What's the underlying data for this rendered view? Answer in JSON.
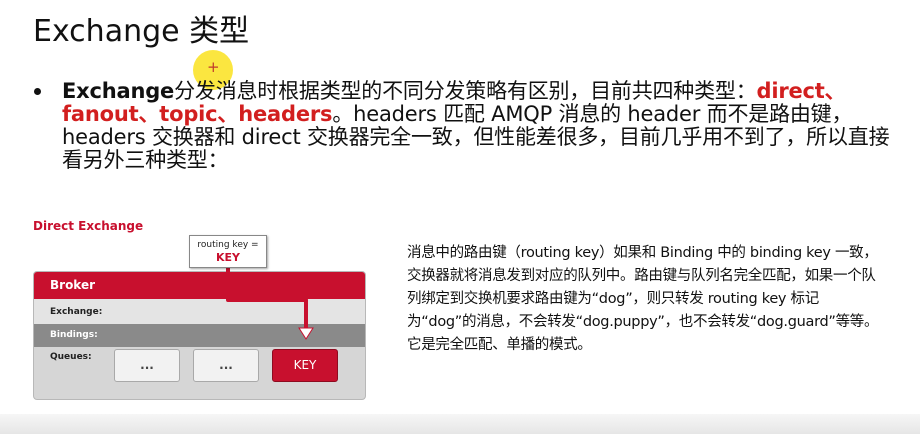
{
  "slide": {
    "title": "Exchange 类型",
    "bullet": {
      "lead": "Exchange",
      "text_1": "分发消息时根据类型的不同分发策略有区别，目前共四种类型：",
      "types": "direct、fanout、topic、headers",
      "text_2": "。headers 匹配 AMQP 消息的 header 而不是路由键， headers 交换器和 direct 交换器完全一致，但性能差很多，目前几乎用不到了，所以直接看另外三种类型："
    },
    "diagram": {
      "title": "Direct Exchange",
      "routing_key_label": "routing key =",
      "routing_key_value": "KEY",
      "broker_label": "Broker",
      "exchange_label": "Exchange:",
      "bindings_label": "Bindings:",
      "queues_label": "Queues:",
      "queues": [
        "...",
        "...",
        "KEY"
      ]
    },
    "description": "消息中的路由键（routing key）如果和 Binding 中的 binding key 一致， 交换器就将消息发到对应的队列中。路由键与队列名完全匹配，如果一个队列绑定到交换机要求路由键为“dog”，则只转发 routing key 标记为“dog”的消息，不会转发“dog.puppy”，也不会转发“dog.guard”等等。它是完全匹配、单播的模式。"
  },
  "colors": {
    "accent_red": "#c8102e",
    "highlight_red": "#d21f1f",
    "cursor_yellow": "#fae21e"
  }
}
